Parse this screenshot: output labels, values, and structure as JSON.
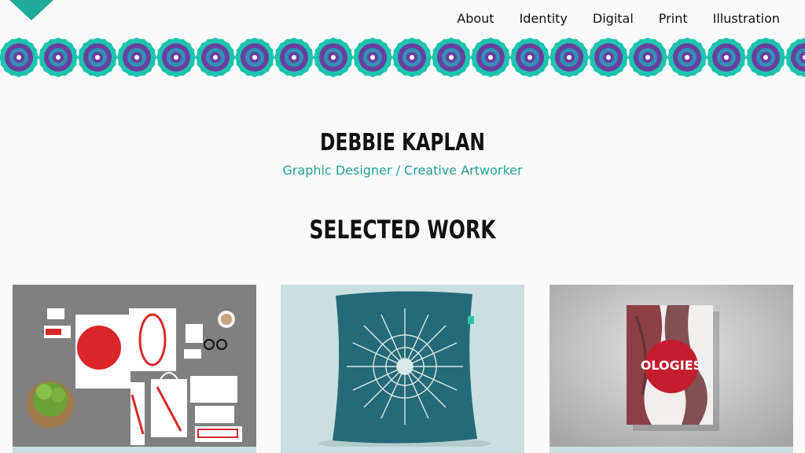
{
  "header": {
    "logo_icon": "teal-triangle-logo",
    "nav": [
      "About",
      "Identity",
      "Digital",
      "Print",
      "Illustration"
    ]
  },
  "band": {
    "motif_icon": "mandala-circle-icon",
    "colors": {
      "outer": "#1cc4ae",
      "inner": "#6a3fa0",
      "core": "#2a9ab8"
    }
  },
  "hero": {
    "name": "DEBBIE KAPLAN",
    "tagline": "Graphic Designer / Creative Artworker"
  },
  "work": {
    "title": "SELECTED WORK",
    "items": [
      {
        "icon": "stationery-mockup-image",
        "label": ""
      },
      {
        "icon": "cushion-pattern-image",
        "label": ""
      },
      {
        "icon": "ologies-book-cover-image",
        "cover_text": "OLOGIES"
      }
    ]
  },
  "colors": {
    "accent": "#23a196",
    "text": "#111111",
    "background": "#fafafa"
  }
}
